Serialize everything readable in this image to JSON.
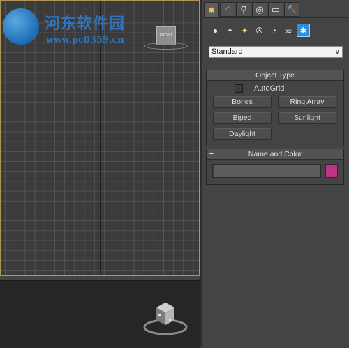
{
  "watermark": {
    "title": "河东软件园",
    "url": "www.pc0359.cn"
  },
  "viewports": {
    "top_viewcube_label": "FRONT",
    "persp_viewcube_label": "FRONT"
  },
  "command_panel": {
    "tabs": [
      {
        "name": "create-icon",
        "glyph": "✸"
      },
      {
        "name": "modify-icon",
        "glyph": "◜"
      },
      {
        "name": "hierarchy-icon",
        "glyph": "⚲"
      },
      {
        "name": "motion-icon",
        "glyph": "◎"
      },
      {
        "name": "display-icon",
        "glyph": "▭"
      },
      {
        "name": "utilities-icon",
        "glyph": "🔨"
      }
    ],
    "categories": [
      {
        "name": "geometry-icon",
        "glyph": "●"
      },
      {
        "name": "shapes-icon",
        "glyph": "◓"
      },
      {
        "name": "lights-icon",
        "glyph": "✦"
      },
      {
        "name": "cameras-icon",
        "glyph": "✇"
      },
      {
        "name": "helpers-icon",
        "glyph": "◔"
      },
      {
        "name": "spacewarps-icon",
        "glyph": "≋"
      },
      {
        "name": "systems-icon",
        "glyph": "✱"
      }
    ],
    "dropdown": {
      "selected": "Standard"
    },
    "object_type": {
      "title": "Object Type",
      "autogrid_label": "AutoGrid",
      "buttons": {
        "bones": "Bones",
        "ring_array": "Ring Array",
        "biped": "Biped",
        "sunlight": "Sunlight",
        "daylight": "Daylight"
      }
    },
    "name_color": {
      "title": "Name and Color",
      "name_value": "",
      "swatch_color": "#c03385"
    }
  },
  "colors": {
    "viewport_border": "#b29456",
    "active_category": "#2f8fdc"
  }
}
